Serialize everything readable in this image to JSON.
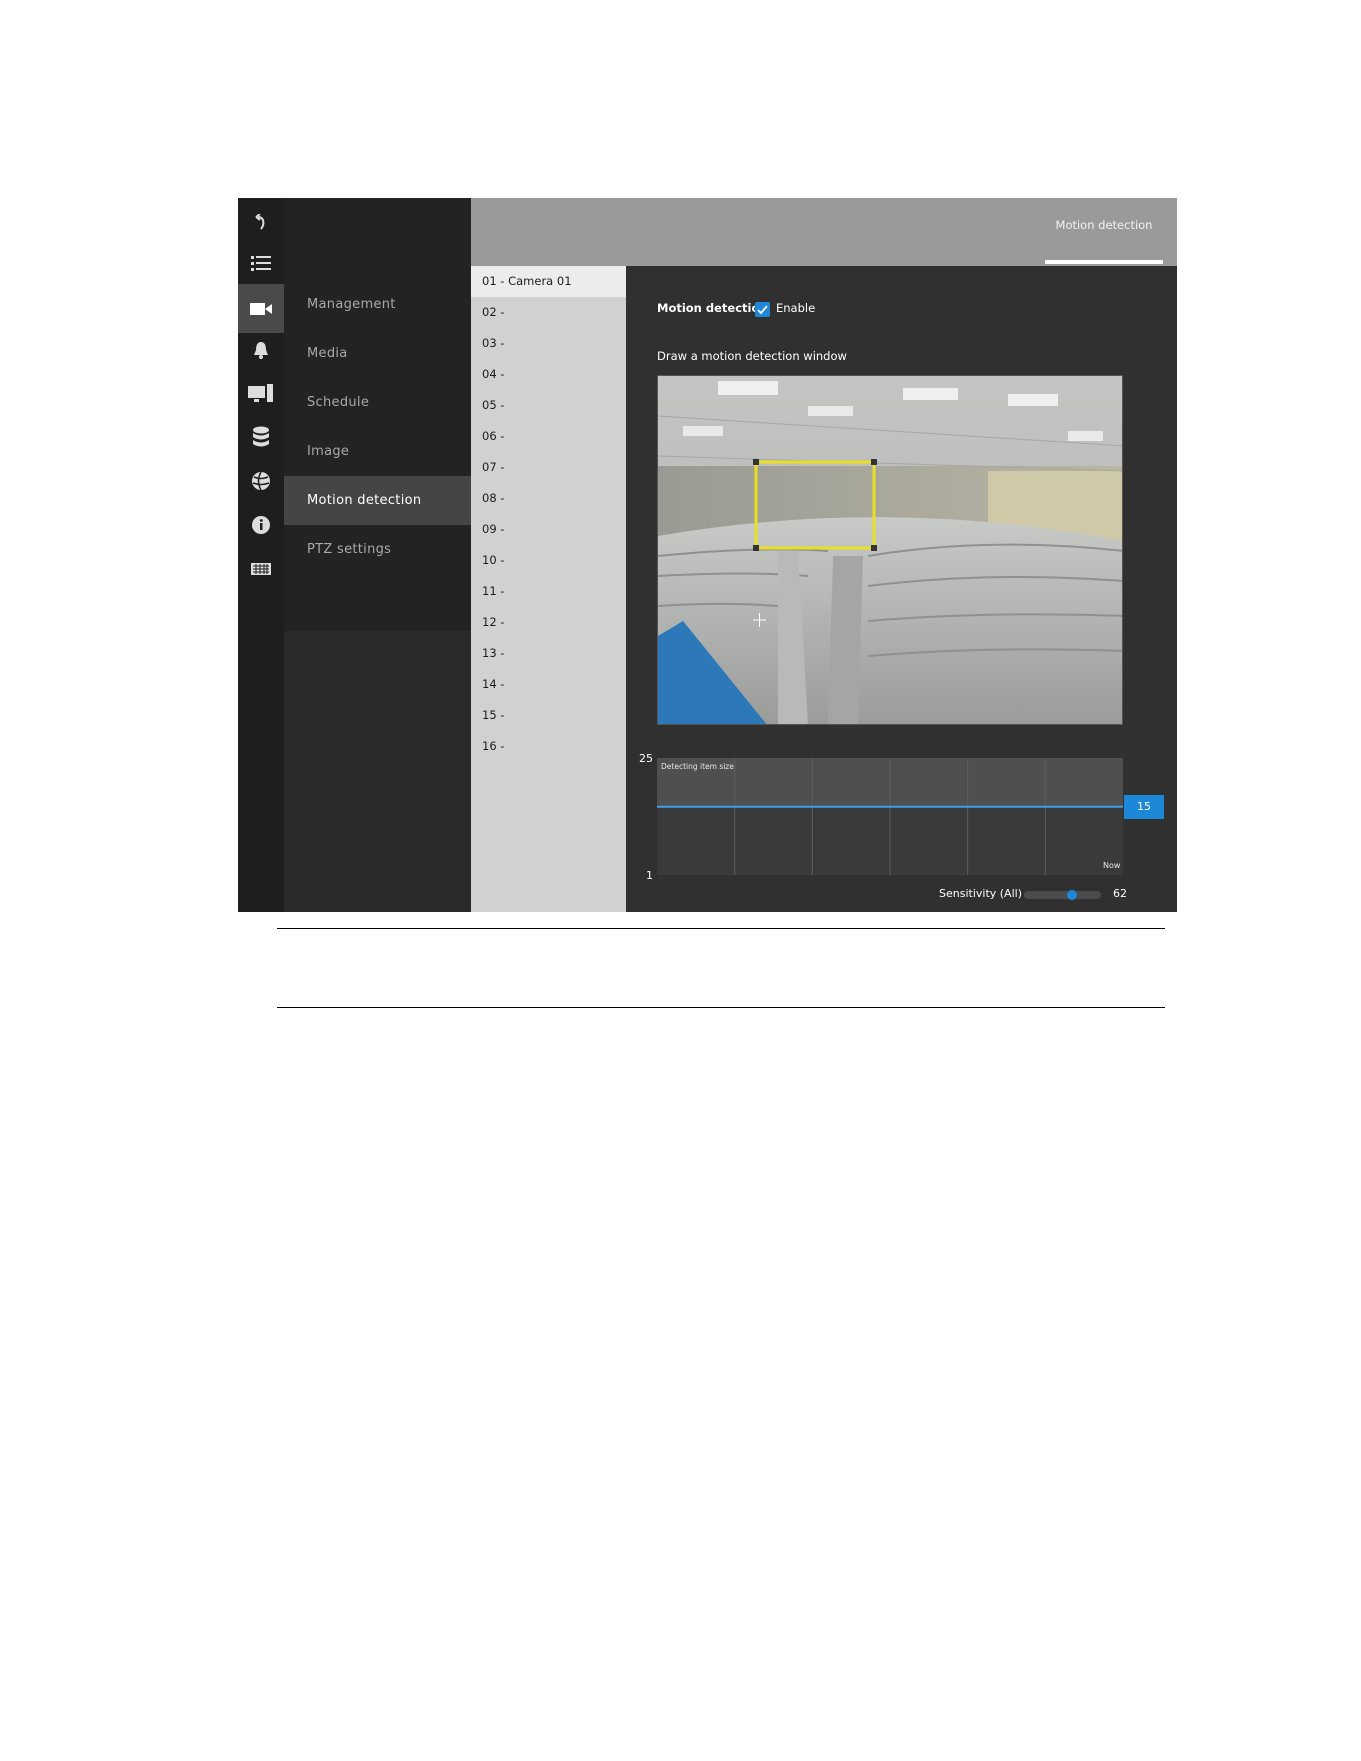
{
  "header": {
    "active_tab": "Motion detection"
  },
  "rail": {
    "icons": [
      "back-icon",
      "list-icon",
      "camera-icon",
      "bell-icon",
      "display-icon",
      "database-icon",
      "globe-icon",
      "info-icon",
      "keyboard-icon"
    ],
    "active_index": 2
  },
  "menu": {
    "items": [
      {
        "label": "Management"
      },
      {
        "label": "Media"
      },
      {
        "label": "Schedule"
      },
      {
        "label": "Image"
      },
      {
        "label": "Motion detection"
      },
      {
        "label": "PTZ settings"
      }
    ],
    "active_index": 4
  },
  "cameras": {
    "items": [
      "01 - Camera 01",
      "02 -",
      "03 -",
      "04 -",
      "05 -",
      "06 -",
      "07 -",
      "08 -",
      "09 -",
      "10 -",
      "11 -",
      "12 -",
      "13 -",
      "14 -",
      "15 -",
      "16 -"
    ],
    "active_index": 0
  },
  "motion": {
    "label": "Motion detection",
    "enable_label": "Enable",
    "enabled": true,
    "window_label": "Draw a motion detection window"
  },
  "chart": {
    "y_max": "25",
    "y_min": "1",
    "title": "Detecting item size",
    "now_label": "Now",
    "item_size": "15",
    "item_size_value": 15,
    "y_range": [
      1,
      25
    ]
  },
  "sensitivity": {
    "label": "Sensitivity (All)",
    "value": "62",
    "value_num": 62,
    "max": 100
  },
  "colors": {
    "accent": "#1e88d8",
    "window": "#e8e020"
  }
}
